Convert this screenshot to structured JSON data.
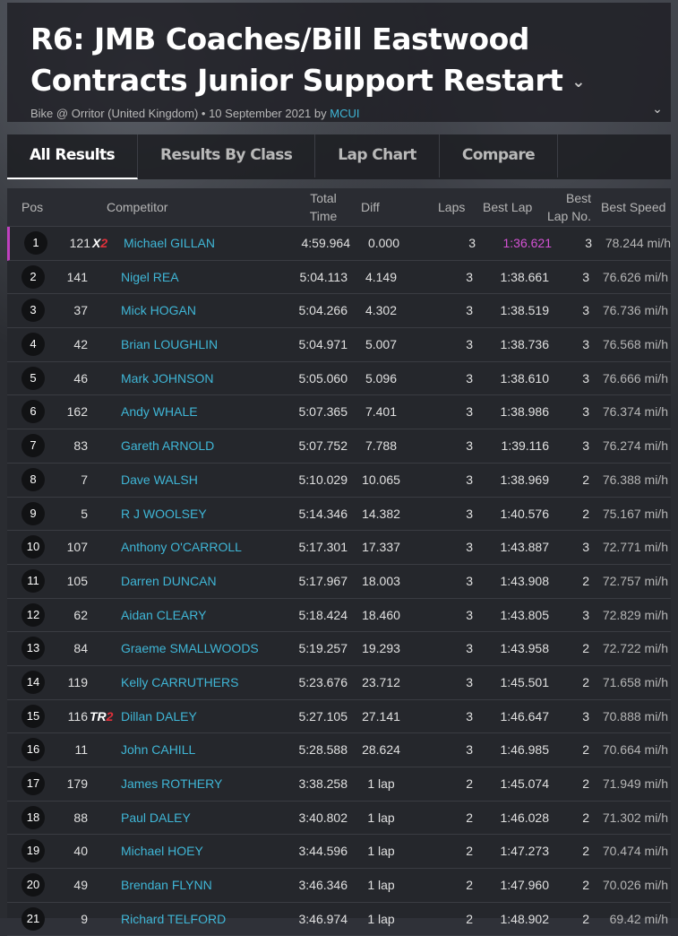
{
  "header": {
    "title": "R6: JMB Coaches/Bill Eastwood Contracts Junior Support Restart",
    "meta_prefix": "Bike @ Orritor (United Kingdom) • 10 September 2021 by ",
    "meta_author": "MCUI"
  },
  "tabs": [
    {
      "label": "All Results",
      "active": true
    },
    {
      "label": "Results By Class",
      "active": false
    },
    {
      "label": "Lap Chart",
      "active": false
    },
    {
      "label": "Compare",
      "active": false
    }
  ],
  "columns": {
    "pos": "Pos",
    "competitor": "Competitor",
    "total_time_1": "Total",
    "total_time_2": "Time",
    "diff": "Diff",
    "laps": "Laps",
    "best_lap": "Best Lap",
    "best_lap_no_1": "Best",
    "best_lap_no_2": "Lap No.",
    "best_speed": "Best Speed"
  },
  "rows": [
    {
      "pos": "1",
      "num": "121",
      "badge": "X",
      "badge_red": "2",
      "name": "Michael GILLAN",
      "total": "4:59.964",
      "diff": "0.000",
      "laps": "3",
      "best": "1:36.621",
      "lapno": "3",
      "speed": "78.244 mi/h",
      "pb": true
    },
    {
      "pos": "2",
      "num": "141",
      "badge": "",
      "badge_red": "",
      "name": "Nigel REA",
      "total": "5:04.113",
      "diff": "4.149",
      "laps": "3",
      "best": "1:38.661",
      "lapno": "3",
      "speed": "76.626 mi/h"
    },
    {
      "pos": "3",
      "num": "37",
      "badge": "",
      "badge_red": "",
      "name": "Mick HOGAN",
      "total": "5:04.266",
      "diff": "4.302",
      "laps": "3",
      "best": "1:38.519",
      "lapno": "3",
      "speed": "76.736 mi/h"
    },
    {
      "pos": "4",
      "num": "42",
      "badge": "",
      "badge_red": "",
      "name": "Brian LOUGHLIN",
      "total": "5:04.971",
      "diff": "5.007",
      "laps": "3",
      "best": "1:38.736",
      "lapno": "3",
      "speed": "76.568 mi/h"
    },
    {
      "pos": "5",
      "num": "46",
      "badge": "",
      "badge_red": "",
      "name": "Mark JOHNSON",
      "total": "5:05.060",
      "diff": "5.096",
      "laps": "3",
      "best": "1:38.610",
      "lapno": "3",
      "speed": "76.666 mi/h"
    },
    {
      "pos": "6",
      "num": "162",
      "badge": "",
      "badge_red": "",
      "name": "Andy WHALE",
      "total": "5:07.365",
      "diff": "7.401",
      "laps": "3",
      "best": "1:38.986",
      "lapno": "3",
      "speed": "76.374 mi/h"
    },
    {
      "pos": "7",
      "num": "83",
      "badge": "",
      "badge_red": "",
      "name": "Gareth ARNOLD",
      "total": "5:07.752",
      "diff": "7.788",
      "laps": "3",
      "best": "1:39.116",
      "lapno": "3",
      "speed": "76.274 mi/h"
    },
    {
      "pos": "8",
      "num": "7",
      "badge": "",
      "badge_red": "",
      "name": "Dave WALSH",
      "total": "5:10.029",
      "diff": "10.065",
      "laps": "3",
      "best": "1:38.969",
      "lapno": "2",
      "speed": "76.388 mi/h"
    },
    {
      "pos": "9",
      "num": "5",
      "badge": "",
      "badge_red": "",
      "name": "R J WOOLSEY",
      "total": "5:14.346",
      "diff": "14.382",
      "laps": "3",
      "best": "1:40.576",
      "lapno": "2",
      "speed": "75.167 mi/h"
    },
    {
      "pos": "10",
      "num": "107",
      "badge": "",
      "badge_red": "",
      "name": "Anthony O'CARROLL",
      "total": "5:17.301",
      "diff": "17.337",
      "laps": "3",
      "best": "1:43.887",
      "lapno": "3",
      "speed": "72.771 mi/h"
    },
    {
      "pos": "11",
      "num": "105",
      "badge": "",
      "badge_red": "",
      "name": "Darren DUNCAN",
      "total": "5:17.967",
      "diff": "18.003",
      "laps": "3",
      "best": "1:43.908",
      "lapno": "2",
      "speed": "72.757 mi/h"
    },
    {
      "pos": "12",
      "num": "62",
      "badge": "",
      "badge_red": "",
      "name": "Aidan CLEARY",
      "total": "5:18.424",
      "diff": "18.460",
      "laps": "3",
      "best": "1:43.805",
      "lapno": "3",
      "speed": "72.829 mi/h"
    },
    {
      "pos": "13",
      "num": "84",
      "badge": "",
      "badge_red": "",
      "name": "Graeme SMALLWOODS",
      "total": "5:19.257",
      "diff": "19.293",
      "laps": "3",
      "best": "1:43.958",
      "lapno": "2",
      "speed": "72.722 mi/h"
    },
    {
      "pos": "14",
      "num": "119",
      "badge": "",
      "badge_red": "",
      "name": "Kelly CARRUTHERS",
      "total": "5:23.676",
      "diff": "23.712",
      "laps": "3",
      "best": "1:45.501",
      "lapno": "2",
      "speed": "71.658 mi/h"
    },
    {
      "pos": "15",
      "num": "116",
      "badge": "TR",
      "badge_red": "2",
      "name": "Dillan DALEY",
      "total": "5:27.105",
      "diff": "27.141",
      "laps": "3",
      "best": "1:46.647",
      "lapno": "3",
      "speed": "70.888 mi/h"
    },
    {
      "pos": "16",
      "num": "11",
      "badge": "",
      "badge_red": "",
      "name": "John CAHILL",
      "total": "5:28.588",
      "diff": "28.624",
      "laps": "3",
      "best": "1:46.985",
      "lapno": "2",
      "speed": "70.664 mi/h"
    },
    {
      "pos": "17",
      "num": "179",
      "badge": "",
      "badge_red": "",
      "name": "James ROTHERY",
      "total": "3:38.258",
      "diff": "1 lap",
      "laps": "2",
      "best": "1:45.074",
      "lapno": "2",
      "speed": "71.949 mi/h"
    },
    {
      "pos": "18",
      "num": "88",
      "badge": "",
      "badge_red": "",
      "name": "Paul DALEY",
      "total": "3:40.802",
      "diff": "1 lap",
      "laps": "2",
      "best": "1:46.028",
      "lapno": "2",
      "speed": "71.302 mi/h"
    },
    {
      "pos": "19",
      "num": "40",
      "badge": "",
      "badge_red": "",
      "name": "Michael HOEY",
      "total": "3:44.596",
      "diff": "1 lap",
      "laps": "2",
      "best": "1:47.273",
      "lapno": "2",
      "speed": "70.474 mi/h"
    },
    {
      "pos": "20",
      "num": "49",
      "badge": "",
      "badge_red": "",
      "name": "Brendan FLYNN",
      "total": "3:46.346",
      "diff": "1 lap",
      "laps": "2",
      "best": "1:47.960",
      "lapno": "2",
      "speed": "70.026 mi/h"
    },
    {
      "pos": "21",
      "num": "9",
      "badge": "",
      "badge_red": "",
      "name": "Richard TELFORD",
      "total": "3:46.974",
      "diff": "1 lap",
      "laps": "2",
      "best": "1:48.902",
      "lapno": "2",
      "speed": "69.42 mi/h"
    }
  ]
}
